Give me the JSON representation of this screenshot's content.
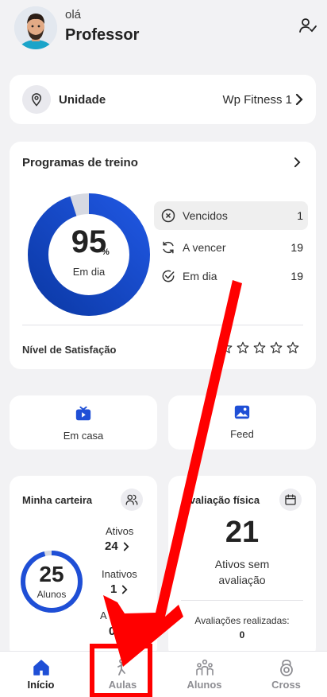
{
  "header": {
    "greeting": "olá",
    "user_name": "Professor",
    "avatar_icon": "avatar",
    "profile_icon": "person-check-icon"
  },
  "unit": {
    "label": "Unidade",
    "value": "Wp Fitness 1",
    "icon": "map-pin-icon"
  },
  "programs": {
    "title": "Programas de treino",
    "percent": "95",
    "percent_symbol": "%",
    "percent_label": "Em dia",
    "progress_fraction": 0.95,
    "stats": [
      {
        "label": "Vencidos",
        "value": "1",
        "icon": "x-circle-icon"
      },
      {
        "label": "A vencer",
        "value": "19",
        "icon": "refresh-icon"
      },
      {
        "label": "Em dia",
        "value": "19",
        "icon": "check-circle-icon"
      }
    ],
    "satisfaction_label": "Nível de Satisfação",
    "stars": 5
  },
  "shortcuts": [
    {
      "label": "Em casa",
      "icon": "tv-play-icon"
    },
    {
      "label": "Feed",
      "icon": "image-icon"
    }
  ],
  "wallet": {
    "title": "Minha carteira",
    "total": "25",
    "total_label": "Alunos",
    "items": [
      {
        "label": "Ativos",
        "value": "24"
      },
      {
        "label": "Inativos",
        "value": "1"
      },
      {
        "label": "A vencer",
        "value": "0"
      }
    ]
  },
  "assessment": {
    "title": "Avaliação física",
    "count": "21",
    "line1": "Ativos sem",
    "line2": "avaliação",
    "done_label": "Avaliações realizadas:",
    "done_value": "0"
  },
  "nav": {
    "items": [
      {
        "label": "Início",
        "icon": "home-icon"
      },
      {
        "label": "Aulas",
        "icon": "dance-class-icon"
      },
      {
        "label": "Alunos",
        "icon": "students-icon"
      },
      {
        "label": "Cross",
        "icon": "kettlebell-icon"
      }
    ],
    "active_index": 0
  },
  "colors": {
    "accent": "#1f4fd6",
    "accent_dark": "#0c2f86",
    "arrow": "#ff0000"
  }
}
